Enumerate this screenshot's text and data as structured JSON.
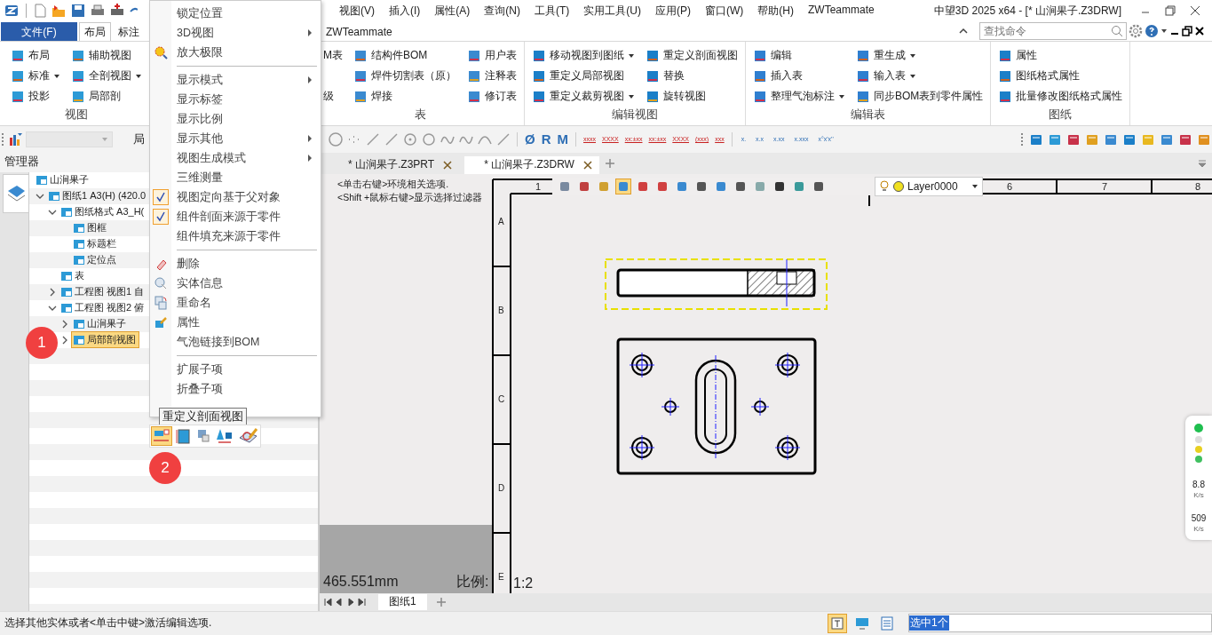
{
  "window": {
    "title": "中望3D 2025 x64 - [* 山涧果子.Z3DRW]"
  },
  "menu_bar": [
    "视图(V)",
    "插入(I)",
    "属性(A)",
    "查询(N)",
    "工具(T)",
    "实用工具(U)",
    "应用(P)",
    "窗口(W)",
    "帮助(H)",
    "ZWTeammate"
  ],
  "ribbon_tabs": [
    {
      "label": "文件(F)",
      "kind": "file",
      "selected": false
    },
    {
      "label": "布局",
      "kind": "tab",
      "selected": true
    },
    {
      "label": "标注",
      "kind": "tab",
      "selected": false
    },
    {
      "label": "ZWTeammate",
      "kind": "tab",
      "selected": false
    }
  ],
  "search": {
    "placeholder": "查找命令"
  },
  "ribbon_groups": [
    {
      "label": "视图",
      "columns": [
        [
          {
            "label": "布局",
            "dropdown": false
          },
          {
            "label": "标准",
            "dropdown": true
          },
          {
            "label": "投影",
            "dropdown": false
          }
        ],
        [
          {
            "label": "辅助视图",
            "dropdown": false
          },
          {
            "label": "全剖视图",
            "dropdown": true
          },
          {
            "label": "局部剖",
            "dropdown": false
          }
        ]
      ]
    },
    {
      "label": "表",
      "columns": [
        [
          {
            "label": "M表",
            "dropdown": false
          },
          {
            "label": "级",
            "dropdown": false
          }
        ],
        [
          {
            "label": "结构件BOM",
            "dropdown": false
          },
          {
            "label": "焊件切割表（原）",
            "dropdown": false
          },
          {
            "label": "焊接",
            "dropdown": false
          }
        ],
        [
          {
            "label": "用户表",
            "dropdown": false
          },
          {
            "label": "注释表",
            "dropdown": false
          },
          {
            "label": "修订表",
            "dropdown": false
          }
        ]
      ]
    },
    {
      "label": "编辑视图",
      "columns": [
        [
          {
            "label": "移动视图到图纸",
            "dropdown": true
          },
          {
            "label": "重定义局部视图",
            "dropdown": false
          },
          {
            "label": "重定义裁剪视图",
            "dropdown": true
          }
        ],
        [
          {
            "label": "重定义剖面视图",
            "dropdown": false
          },
          {
            "label": "替换",
            "dropdown": false
          },
          {
            "label": "旋转视图",
            "dropdown": false
          }
        ]
      ]
    },
    {
      "label": "编辑表",
      "columns": [
        [
          {
            "label": "编辑",
            "dropdown": false
          },
          {
            "label": "插入表",
            "dropdown": false
          },
          {
            "label": "整理气泡标注",
            "dropdown": true
          }
        ],
        [
          {
            "label": "重生成",
            "dropdown": true
          },
          {
            "label": "输入表",
            "dropdown": true
          },
          {
            "label": "同步BOM表到零件属性",
            "dropdown": false
          }
        ]
      ]
    },
    {
      "label": "图纸",
      "columns": [
        [
          {
            "label": "属性",
            "dropdown": false
          },
          {
            "label": "图纸格式属性",
            "dropdown": false
          },
          {
            "label": "批量修改图纸格式属性",
            "dropdown": false
          }
        ]
      ]
    }
  ],
  "toolbar": {
    "partial_label": "局",
    "symbols": [
      "Ø",
      "R",
      "M"
    ],
    "formats": [
      "xxxx",
      "XXXX",
      "xx:±xx",
      "xx:±xx",
      "XXXX",
      "(xxx)",
      "xxx"
    ],
    "precisions": [
      "x.",
      "x.x",
      "x.xx",
      "x.xxx",
      "x°x'x''"
    ]
  },
  "manager": {
    "title": "管理器",
    "tree": [
      {
        "label": "山涧果子",
        "selected": false,
        "children": [
          {
            "label": "图纸1 A3(H) (420.0",
            "expanded": true,
            "selected": false,
            "children": [
              {
                "label": "图纸格式 A3_H(",
                "expanded": true,
                "selected": false,
                "children": [
                  {
                    "label": "图框",
                    "selected": false
                  },
                  {
                    "label": "标题栏",
                    "selected": false
                  },
                  {
                    "label": "定位点",
                    "selected": false
                  }
                ]
              },
              {
                "label": "表",
                "selected": false
              },
              {
                "label": "工程图 视图1 自",
                "expanded": false,
                "selected": false
              },
              {
                "label": "工程图 视图2 俯",
                "expanded": true,
                "selected": false,
                "children": [
                  {
                    "label": "山涧果子",
                    "expanded": false,
                    "selected": false
                  },
                  {
                    "label": "局部剖视图",
                    "expanded": false,
                    "selected": true
                  }
                ]
              }
            ]
          }
        ]
      }
    ]
  },
  "context_menu": [
    {
      "kind": "item",
      "label": "锁定位置"
    },
    {
      "kind": "submenu",
      "label": "3D视图"
    },
    {
      "kind": "item",
      "label": "放大极限"
    },
    {
      "kind": "separator"
    },
    {
      "kind": "submenu",
      "label": "显示模式"
    },
    {
      "kind": "item",
      "label": "显示标签"
    },
    {
      "kind": "item",
      "label": "显示比例"
    },
    {
      "kind": "submenu",
      "label": "显示其他"
    },
    {
      "kind": "submenu",
      "label": "视图生成模式"
    },
    {
      "kind": "item",
      "label": "三维测量"
    },
    {
      "kind": "check",
      "label": "视图定向基于父对象",
      "checked": true
    },
    {
      "kind": "check",
      "label": "组件剖面来源于零件",
      "checked": true
    },
    {
      "kind": "check",
      "label": "组件填充来源于零件",
      "checked": false
    },
    {
      "kind": "separator"
    },
    {
      "kind": "item",
      "label": "删除"
    },
    {
      "kind": "item",
      "label": "实体信息"
    },
    {
      "kind": "item",
      "label": "重命名"
    },
    {
      "kind": "item",
      "label": "属性"
    },
    {
      "kind": "item",
      "label": "气泡链接到BOM"
    },
    {
      "kind": "separator"
    },
    {
      "kind": "item",
      "label": "扩展子项"
    },
    {
      "kind": "item",
      "label": "折叠子项"
    }
  ],
  "tooltip": "重定义剖面视图",
  "badges": [
    "1",
    "2"
  ],
  "document_tabs": [
    {
      "label": "* 山涧果子.Z3PRT",
      "selected": false
    },
    {
      "label": "* 山涧果子.Z3DRW",
      "selected": true
    }
  ],
  "canvas": {
    "hints": [
      "<单击右键>环境相关选项.",
      "<Shift +鼠标右键>显示选择过滤器"
    ],
    "layer": "Layer0000",
    "column_labels": [
      "1",
      "6",
      "7",
      "8"
    ],
    "row_labels": [
      "A",
      "B",
      "C",
      "D",
      "E"
    ],
    "length": "465.551mm",
    "scale_label": "比例:",
    "scale": "1:2"
  },
  "sheet_tabs": [
    {
      "label": "图纸1",
      "selected": true
    }
  ],
  "net_widget": {
    "upload": "8.8",
    "upload_unit": "K/s",
    "download": "509",
    "download_unit": "K/s"
  },
  "status_bar": {
    "message": "选择其他实体或者<单击中键>激活编辑选项.",
    "selection": "选中1个"
  }
}
